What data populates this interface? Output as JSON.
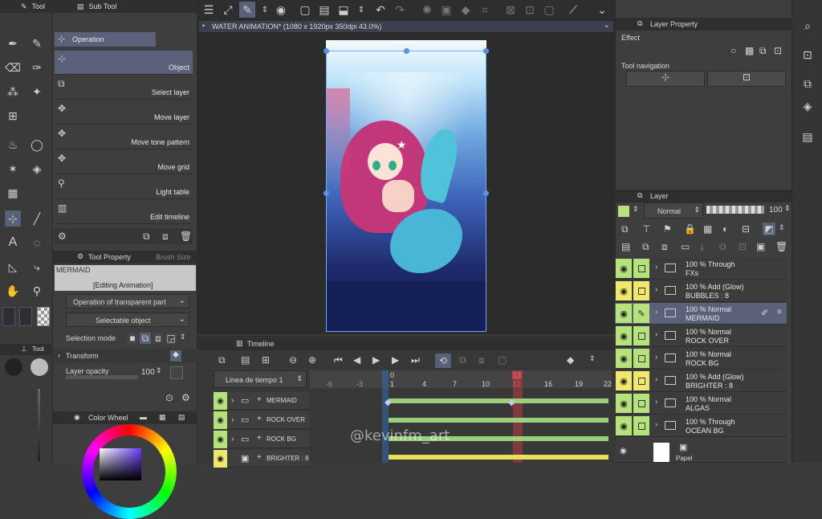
{
  "menu": {
    "sub_tool_tab": "Sub Tool",
    "tool_tab": "Tool"
  },
  "subtool": {
    "category": "Operation",
    "items": [
      {
        "label": "Object",
        "selected": true
      },
      {
        "label": "Select layer"
      },
      {
        "label": "Move layer"
      },
      {
        "label": "Move tone pattern"
      },
      {
        "label": "Move grid"
      },
      {
        "label": "Light table"
      },
      {
        "label": "Edit timeline"
      }
    ]
  },
  "tool_property": {
    "title": "Tool Property",
    "brush_tab": "Brush Size",
    "preview_name": "MERMAID",
    "preview_caption": "[Editing Animation]",
    "transparent_op": "Operation of transparent part",
    "selectable": "Selectable object",
    "selection_mode": "Selection mode",
    "transform": "Transform",
    "layer_opacity": "Layer opacity",
    "opacity_value": "100"
  },
  "color_wheel": {
    "title": "Color Wheel"
  },
  "canvas": {
    "tab_title": "WATER ANIMATION* (1080 x 1920px 350dpi 43.0%)"
  },
  "timeline": {
    "title": "Timeline",
    "name": "Linea de tiempo 1",
    "ticks": [
      "-6",
      "-3",
      "1",
      "4",
      "7",
      "10",
      "13",
      "16",
      "19",
      "22"
    ],
    "start_marker": "0",
    "current_frame": "13",
    "rows": [
      {
        "label": "MERMAID"
      },
      {
        "label": "ROCK OVER"
      },
      {
        "label": "ROCK BG"
      },
      {
        "label": "BRIGHTER : 8"
      }
    ],
    "watermark": "@kevinfm_art"
  },
  "layer_property": {
    "title": "Layer Property",
    "effect": "Effect",
    "tool_nav": "Tool navigation"
  },
  "layer_panel": {
    "title": "Layer",
    "blend": "Normal",
    "opacity": "100",
    "layers": [
      {
        "opacity": "100 %",
        "mode": "Through",
        "name": "FXs",
        "lit": true
      },
      {
        "opacity": "100 %",
        "mode": "Add (Glow)",
        "name": "BUBBLES : 8",
        "lit": false
      },
      {
        "opacity": "100 %",
        "mode": "Normal",
        "name": "MERMAID",
        "lit": true,
        "selected": true
      },
      {
        "opacity": "100 %",
        "mode": "Normal",
        "name": "ROCK OVER",
        "lit": true
      },
      {
        "opacity": "100 %",
        "mode": "Normal",
        "name": "ROCK BG",
        "lit": true
      },
      {
        "opacity": "100 %",
        "mode": "Add (Glow)",
        "name": "BRIGHTER : 8",
        "lit": false
      },
      {
        "opacity": "100 %",
        "mode": "Normal",
        "name": "ALGAS",
        "lit": true
      },
      {
        "opacity": "100 %",
        "mode": "Through",
        "name": "OCEAN BG",
        "lit": true
      }
    ],
    "paper": "Papel"
  },
  "colors": {
    "accent": "#b5e27a",
    "yellow": "#f0e86a",
    "selection": "#5a6178"
  }
}
